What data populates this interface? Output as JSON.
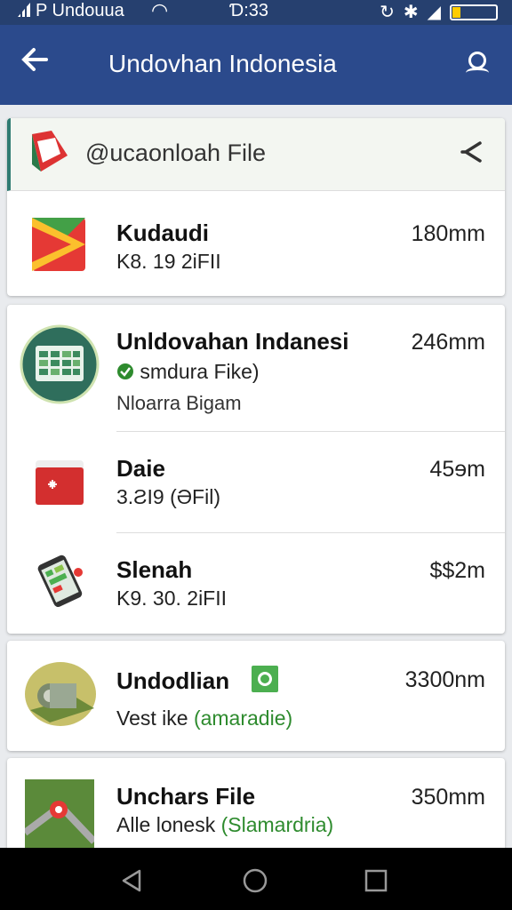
{
  "status_bar": {
    "carrier": "P Undouua",
    "time": "Ɗ:33",
    "icons": [
      "signal-icon",
      "wifi-icon",
      "sync-icon",
      "bluetooth-icon",
      "cellular-icon",
      "battery-icon"
    ]
  },
  "app_bar": {
    "title": "Undovhan Indonesia",
    "back_icon": "back-arrow-icon",
    "search_icon": "search-icon"
  },
  "folder": {
    "label": "@ucaonloah File",
    "icon": "folder-icon",
    "collapse_icon": "chevron-icon"
  },
  "items": [
    {
      "name": "Kudaudi",
      "detail": "K8. 19 2iFII",
      "size": "180mm",
      "icon": "google-play-icon"
    },
    {
      "name": "Unldovahan Indanesi",
      "detail": "smdura Fike)",
      "detail2": "Nloarra Bigam",
      "size": "246mm",
      "icon": "spreadsheet-app-icon",
      "verified": true
    },
    {
      "name": "Daie",
      "detail": "3.ƧI9 (ƏFil)",
      "size": "45ɘm",
      "icon": "red-folder-icon"
    },
    {
      "name": "Slenah",
      "detail": "K9. 30. 2iFII",
      "size": "$$2m",
      "icon": "phone-icon"
    },
    {
      "name": "Undodlian",
      "detail": "Vest ike",
      "detail_tag": "(amaradie)",
      "size": "3300nm",
      "icon": "tape-roll-icon",
      "badge_icon": "chat-badge-icon"
    },
    {
      "name": "Unchars File",
      "detail": "Alle lonesk",
      "detail_tag": "(Slamardria)",
      "size": "350mm",
      "icon": "map-icon"
    }
  ],
  "nav_bar": {
    "icons": [
      "nav-back-icon",
      "nav-home-icon",
      "nav-recents-icon"
    ]
  },
  "colors": {
    "app_bar": "#2b4a8c",
    "status_bar": "#26406f",
    "accent_green": "#2e8b2e",
    "folder_accent": "#2f7b72"
  }
}
